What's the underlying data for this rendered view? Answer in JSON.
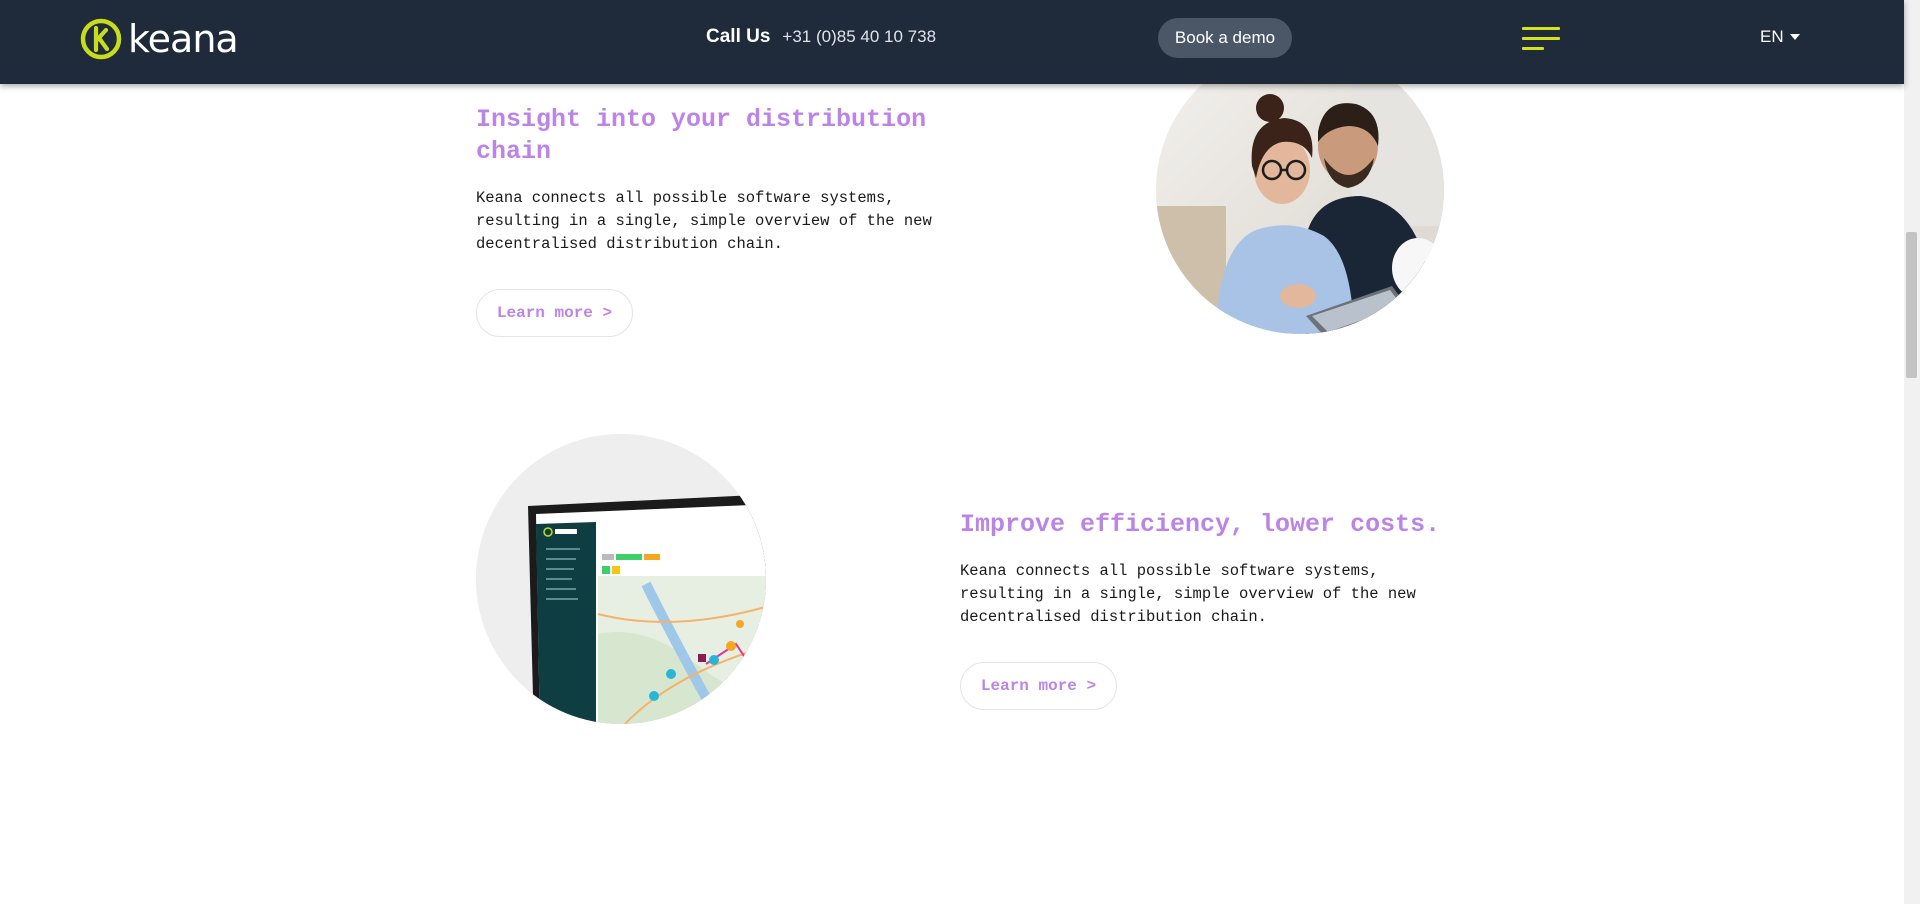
{
  "header": {
    "logo_text": "keana",
    "call_label": "Call Us",
    "phone": "+31 (0)85 40 10 738",
    "demo_label": "Book a demo",
    "language": "EN",
    "menu_icon": "hamburger-menu-icon",
    "colors": {
      "background": "#1f2a3a",
      "logo_accent": "#c8dc1e",
      "menu_lines": "#d6e21a",
      "demo_button": "#4b5667"
    }
  },
  "sections": [
    {
      "title": "Insight into your distribution chain",
      "body": "Keana connects all possible software systems, resulting in a single, simple overview of the new decentralised distribution chain.",
      "cta": "Learn more >"
    },
    {
      "title": "Improve efficiency, lower costs.",
      "body": "Keana connects all possible software systems, resulting in a single, simple overview of the new decentralised distribution chain.",
      "cta": "Learn more >"
    }
  ],
  "accent_color": "#bc84e6"
}
